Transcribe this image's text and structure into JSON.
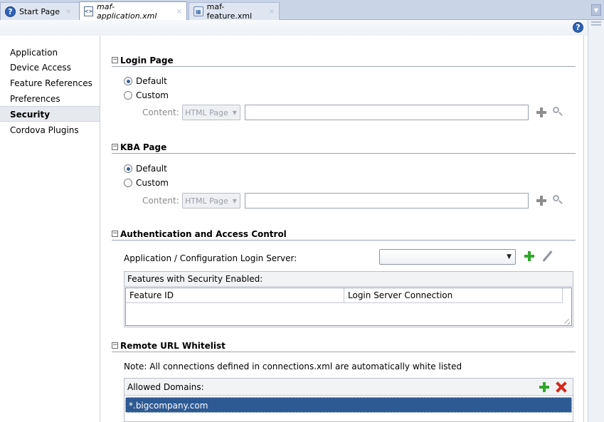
{
  "tabs": [
    {
      "label": "Start Page",
      "icon": "help-icon",
      "active": false
    },
    {
      "label": "maf-application.xml",
      "icon": "xml-file-icon",
      "active": true
    },
    {
      "label": "maf-feature.xml",
      "icon": "feature-file-icon",
      "active": false
    }
  ],
  "tab_close": "×",
  "help_glyph": "?",
  "xml_glyph": "<>",
  "feat_glyph": "▦",
  "sidebar": {
    "items": [
      {
        "label": "Application",
        "selected": false
      },
      {
        "label": "Device Access",
        "selected": false
      },
      {
        "label": "Feature References",
        "selected": false
      },
      {
        "label": "Preferences",
        "selected": false
      },
      {
        "label": "Security",
        "selected": true
      },
      {
        "label": "Cordova Plugins",
        "selected": false
      }
    ]
  },
  "sections": {
    "login": {
      "title": "Login Page",
      "option_default": "Default",
      "option_custom": "Custom",
      "selected": "Default",
      "content_label": "Content:",
      "content_type": "HTML Page",
      "content_value": ""
    },
    "kba": {
      "title": "KBA Page",
      "option_default": "Default",
      "option_custom": "Custom",
      "selected": "Default",
      "content_label": "Content:",
      "content_type": "HTML Page",
      "content_value": ""
    },
    "auth": {
      "title": "Authentication and Access Control",
      "login_server_label": "Application / Configuration Login Server:",
      "login_server_value": "",
      "features_caption": "Features with Security Enabled:",
      "columns": [
        "Feature ID",
        "Login Server Connection"
      ]
    },
    "whitelist": {
      "title": "Remote URL Whitelist",
      "note": "Note: All connections defined in connections.xml are automatically white listed",
      "domains_caption": "Allowed Domains:",
      "domains": [
        "*.bigcompany.com"
      ]
    }
  },
  "collapse_glyph": "−",
  "dropdown_glyph": "▼",
  "colors": {
    "accent": "#2e5a93",
    "add_green": "#2fa82a",
    "remove_red": "#d8261a",
    "tab_bar": "#c9d4e6"
  }
}
